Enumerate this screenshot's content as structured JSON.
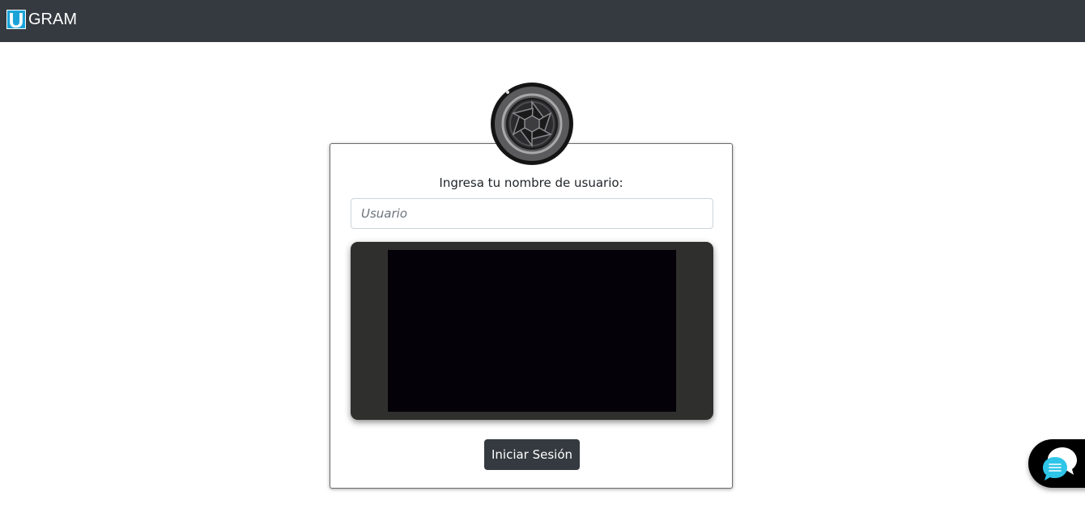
{
  "navbar": {
    "logo_letter": "U",
    "brand_name": "GRAM",
    "background": "#343a40",
    "logo_color": "#1aa3d9"
  },
  "badge": {
    "icon": "camera-aperture-icon"
  },
  "login_card": {
    "prompt": "Ingresa tu nombre de usuario:",
    "username": {
      "placeholder": "Usuario",
      "value": ""
    },
    "webcam": {
      "state": "video-feed-dark"
    },
    "submit_label": "Iniciar Sesión"
  },
  "chat_widget": {
    "icon": "chat-bubbles-icon",
    "accent": "#2ec5e8"
  }
}
